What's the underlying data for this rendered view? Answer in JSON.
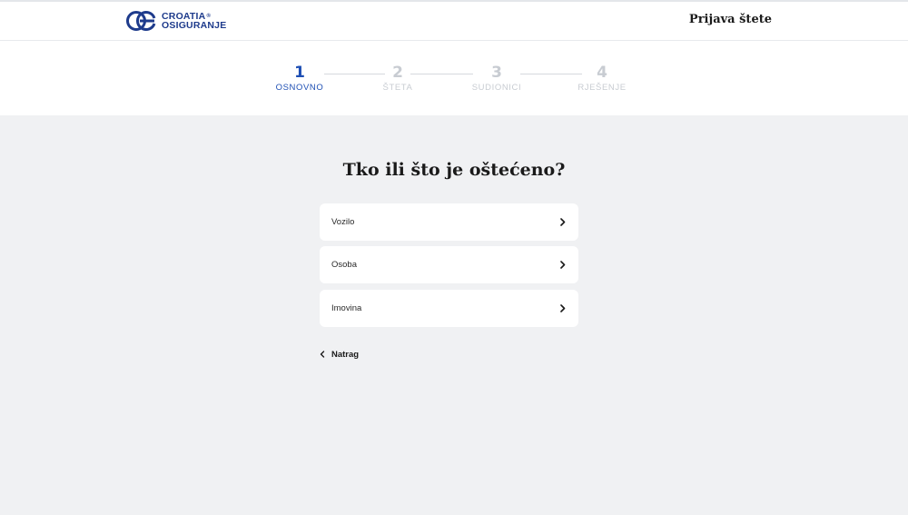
{
  "header": {
    "logo": {
      "line1": "CROATIA",
      "registered": "®",
      "line2": "OSIGURANJE"
    },
    "title": "Prijava štete"
  },
  "stepper": {
    "steps": [
      {
        "number": "1",
        "label": "OSNOVNO",
        "active": true
      },
      {
        "number": "2",
        "label": "ŠTETA",
        "active": false
      },
      {
        "number": "3",
        "label": "SUDIONICI",
        "active": false
      },
      {
        "number": "4",
        "label": "RJEŠENJE",
        "active": false
      }
    ]
  },
  "main": {
    "question": "Tko ili što je oštećeno?",
    "options": [
      {
        "label": "Vozilo",
        "icon": "chevron-right-icon"
      },
      {
        "label": "Osoba",
        "icon": "chevron-right-icon"
      },
      {
        "label": "Imovina",
        "icon": "chevron-right-icon"
      }
    ],
    "back_label": "Natrag"
  },
  "colors": {
    "brand_blue": "#1e3b8c",
    "active_step": "#1e4fb4",
    "inactive_step": "#c8ccd2",
    "page_background": "#f0f1f3"
  }
}
